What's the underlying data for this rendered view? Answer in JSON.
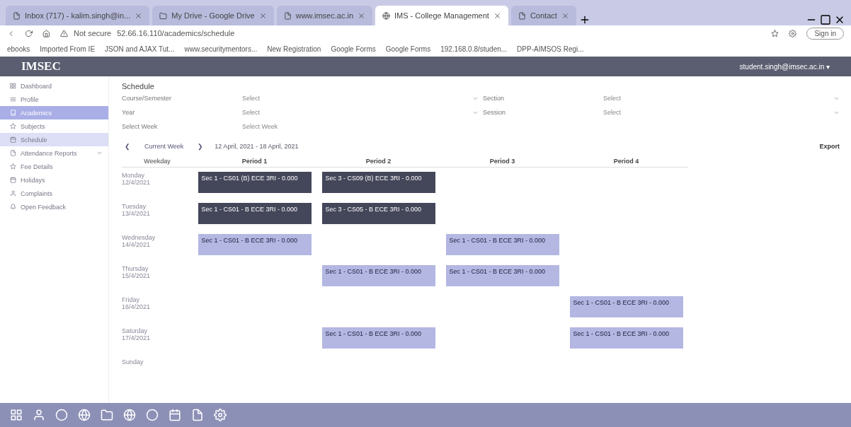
{
  "browser": {
    "tabs": [
      {
        "label": "Inbox (717) - kalim.singh@in...",
        "selected": false
      },
      {
        "label": "My Drive - Google Drive",
        "selected": false
      },
      {
        "label": "www.imsec.ac.in",
        "selected": false
      },
      {
        "label": "IMS - College Management",
        "selected": true
      },
      {
        "label": "Contact",
        "selected": false
      }
    ],
    "security": "Not secure",
    "url": "52.66.16.110/academics/schedule",
    "sign_in": "Sign in",
    "bookmarks": [
      "ebooks",
      "Imported From IE",
      "JSON and AJAX Tut...",
      "www.securitymentors...",
      "New Registration",
      "Google Forms",
      "Google Forms",
      "192.168.0.8/studen...",
      "DPP-AIMSOS Regi..."
    ]
  },
  "header": {
    "logo": "IMSEC",
    "user": "student.singh@imsec.ac.in ▾"
  },
  "sidebar": {
    "items": [
      {
        "label": "Dashboard",
        "selected": false
      },
      {
        "label": "Profile",
        "selected": false
      },
      {
        "label": "Academics",
        "selected": true
      },
      {
        "label": "Subjects",
        "selected": false
      },
      {
        "label": "Schedule",
        "selected": false,
        "highlighted": true
      },
      {
        "label": "Attendance Reports",
        "selected": false,
        "expandable": true
      },
      {
        "label": "Fee Details",
        "selected": false
      },
      {
        "label": "Holidays",
        "selected": false
      },
      {
        "label": "Complaints",
        "selected": false
      },
      {
        "label": "Open Feedback",
        "selected": false
      }
    ]
  },
  "page": {
    "title": "Schedule",
    "filters": [
      {
        "label": "Course/Semester",
        "value": "Select",
        "dropdown": true
      },
      {
        "label": "Section",
        "value": "Select",
        "dropdown": true
      },
      {
        "label": "Year",
        "value": "Select",
        "dropdown": true
      },
      {
        "label": "Session",
        "value": "Select",
        "dropdown": true
      },
      {
        "label": "Select Week",
        "value": "Select Week",
        "dropdown": false
      }
    ],
    "week": {
      "prev": "❮",
      "current": "Current Week",
      "next": "❯",
      "range": "12 April, 2021 - 18 April, 2021"
    },
    "export": "Export",
    "weekday_header": "Weekday",
    "columns": [
      "Period 1",
      "Period 2",
      "Period 3",
      "Period 4"
    ],
    "rows": [
      {
        "day": "Monday",
        "date": "12/4/2021",
        "cells": [
          {
            "text": "Sec 1 - CS01 (B) ECE 3RI - 0.000",
            "kind": "past"
          },
          {
            "text": "Sec 3 - CS09 (B) ECE 3RI - 0.000",
            "kind": "past"
          },
          null,
          null
        ]
      },
      {
        "day": "Tuesday",
        "date": "13/4/2021",
        "cells": [
          {
            "text": "Sec 1 - CS01 - B ECE 3RI - 0.000",
            "kind": "past"
          },
          {
            "text": "Sec 3 - CS05 - B ECE 3RI - 0.000",
            "kind": "past"
          },
          null,
          null
        ]
      },
      {
        "day": "Wednesday",
        "date": "14/4/2021",
        "cells": [
          {
            "text": "Sec 1 - CS01 - B ECE 3RI - 0.000",
            "kind": "upcoming"
          },
          null,
          {
            "text": "Sec 1 - CS01 - B ECE 3RI - 0.000",
            "kind": "upcoming"
          },
          null
        ]
      },
      {
        "day": "Thursday",
        "date": "15/4/2021",
        "cells": [
          null,
          {
            "text": "Sec 1 - CS01 - B ECE 3RI - 0.000",
            "kind": "upcoming"
          },
          {
            "text": "Sec 1 - CS01 - B ECE 3RI - 0.000",
            "kind": "upcoming"
          },
          null
        ]
      },
      {
        "day": "Friday",
        "date": "16/4/2021",
        "cells": [
          null,
          null,
          null,
          {
            "text": "Sec 1 - CS01 - B ECE 3RI - 0.000",
            "kind": "upcoming"
          }
        ]
      },
      {
        "day": "Saturday",
        "date": "17/4/2021",
        "cells": [
          null,
          {
            "text": "Sec 1 - CS01 - B ECE 3RI - 0.000",
            "kind": "upcoming"
          },
          null,
          {
            "text": "Sec 1 - CS01 - B ECE 3RI - 0.000",
            "kind": "upcoming"
          }
        ]
      },
      {
        "day": "Sunday",
        "cells": [
          null,
          null,
          null,
          null
        ]
      }
    ]
  }
}
